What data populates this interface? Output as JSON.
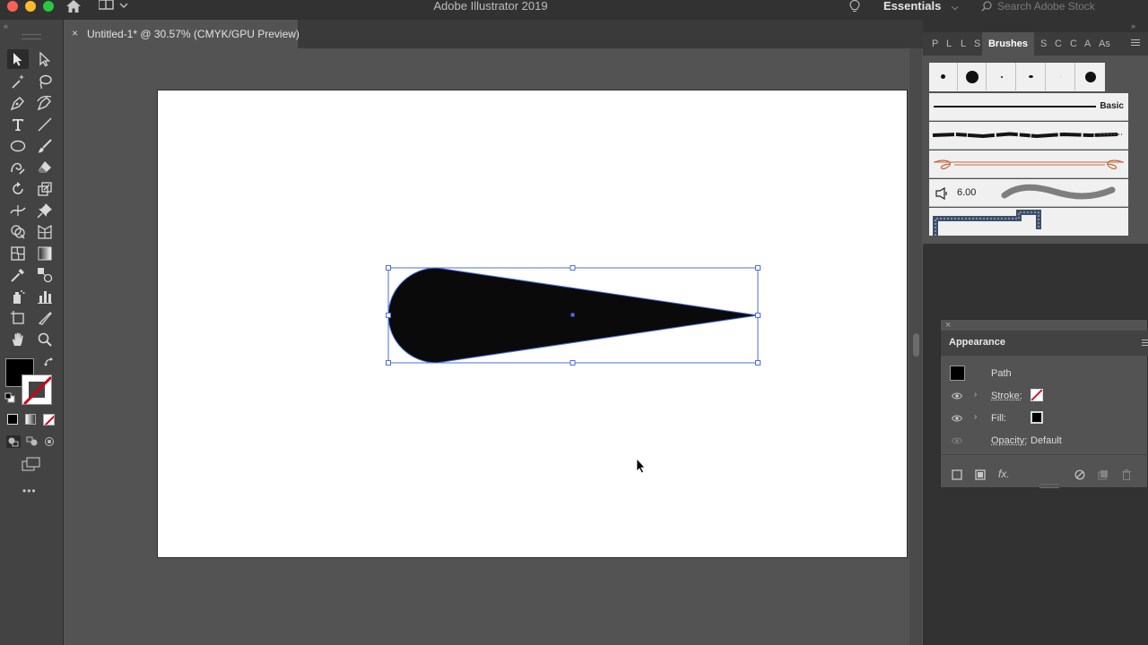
{
  "app": {
    "title": "Adobe Illustrator 2019",
    "workspace": "Essentials",
    "search_placeholder": "Search Adobe Stock"
  },
  "document": {
    "tab_close": "×",
    "tab_label": "Untitled-1* @ 30.57% (CMYK/GPU Preview)"
  },
  "brushes_panel": {
    "tabs": [
      "P",
      "L",
      "L",
      "S",
      "Brushes",
      "S",
      "C",
      "C",
      "A",
      "As"
    ],
    "active_tab": "Brushes",
    "basic_label": "Basic",
    "bristle_value": "6.00"
  },
  "appearance_panel": {
    "title": "Appearance",
    "object_label": "Path",
    "stroke_label": "Stroke:",
    "fill_label": "Fill:",
    "opacity_label": "Opacity:",
    "opacity_value": "Default"
  },
  "toolbar": {
    "more_label": "•••"
  },
  "colors": {
    "selection": "#4a6fe3",
    "fill": "#0a0a0a",
    "stroke_none": "#d0021b"
  }
}
